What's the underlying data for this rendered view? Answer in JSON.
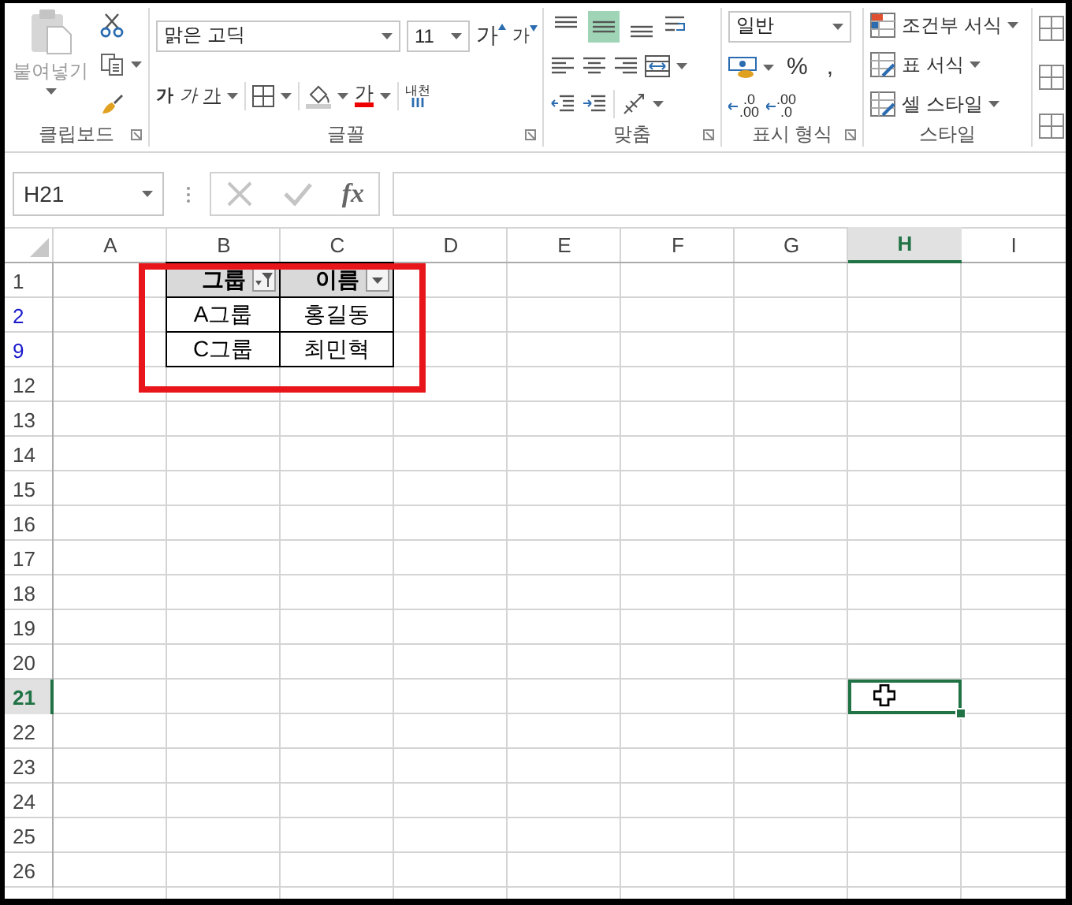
{
  "ribbon": {
    "clipboard": {
      "paste_label": "붙여넣기",
      "group_label": "클립보드"
    },
    "font": {
      "font_name": "맑은 고딕",
      "font_size": "11",
      "grow_label": "가",
      "shrink_label": "가",
      "bold_label": "가",
      "italic_label": "가",
      "underline_label": "가",
      "font_color_label": "가",
      "phonetic_label": "내천",
      "group_label": "글꼴"
    },
    "alignment": {
      "vertical_buttons": [
        {
          "kind": "top",
          "selected": false
        },
        {
          "kind": "middle",
          "selected": true
        },
        {
          "kind": "bottom",
          "selected": false
        }
      ],
      "group_label": "맞춤"
    },
    "number": {
      "format": "일반",
      "percent_label": "%",
      "comma_label": ",",
      "increase_decimal": [
        ".0",
        ".00"
      ],
      "decrease_decimal": [
        ".00",
        ".0"
      ],
      "group_label": "표시 형식"
    },
    "styles": {
      "items": [
        "조건부 서식",
        "표 서식",
        "셀 스타일"
      ],
      "group_label": "스타일"
    }
  },
  "formula_bar": {
    "name_box": "H21",
    "function_label": "fx"
  },
  "sheet": {
    "columns": [
      {
        "label": "A",
        "selected": false
      },
      {
        "label": "B",
        "selected": false
      },
      {
        "label": "C",
        "selected": false
      },
      {
        "label": "D",
        "selected": false
      },
      {
        "label": "E",
        "selected": false
      },
      {
        "label": "F",
        "selected": false
      },
      {
        "label": "G",
        "selected": false
      },
      {
        "label": "H",
        "selected": true
      },
      {
        "label": "I",
        "selected": false
      }
    ],
    "rows": [
      {
        "label": "1",
        "filtered": false,
        "selected": false
      },
      {
        "label": "2",
        "filtered": true,
        "selected": false
      },
      {
        "label": "9",
        "filtered": true,
        "selected": false
      },
      {
        "label": "12",
        "filtered": false,
        "selected": false
      },
      {
        "label": "13",
        "filtered": false,
        "selected": false
      },
      {
        "label": "14",
        "filtered": false,
        "selected": false
      },
      {
        "label": "15",
        "filtered": false,
        "selected": false
      },
      {
        "label": "16",
        "filtered": false,
        "selected": false
      },
      {
        "label": "17",
        "filtered": false,
        "selected": false
      },
      {
        "label": "18",
        "filtered": false,
        "selected": false
      },
      {
        "label": "19",
        "filtered": false,
        "selected": false
      },
      {
        "label": "20",
        "filtered": false,
        "selected": false
      },
      {
        "label": "21",
        "filtered": false,
        "selected": true
      },
      {
        "label": "22",
        "filtered": false,
        "selected": false
      },
      {
        "label": "23",
        "filtered": false,
        "selected": false
      },
      {
        "label": "24",
        "filtered": false,
        "selected": false
      },
      {
        "label": "25",
        "filtered": false,
        "selected": false
      },
      {
        "label": "26",
        "filtered": false,
        "selected": false
      }
    ],
    "table": {
      "headers": [
        {
          "text": "그룹",
          "filter_applied": true
        },
        {
          "text": "이름",
          "filter_applied": false
        }
      ],
      "rows": [
        [
          "A그룹",
          "홍길동"
        ],
        [
          "C그룹",
          "최민혁"
        ]
      ]
    }
  }
}
